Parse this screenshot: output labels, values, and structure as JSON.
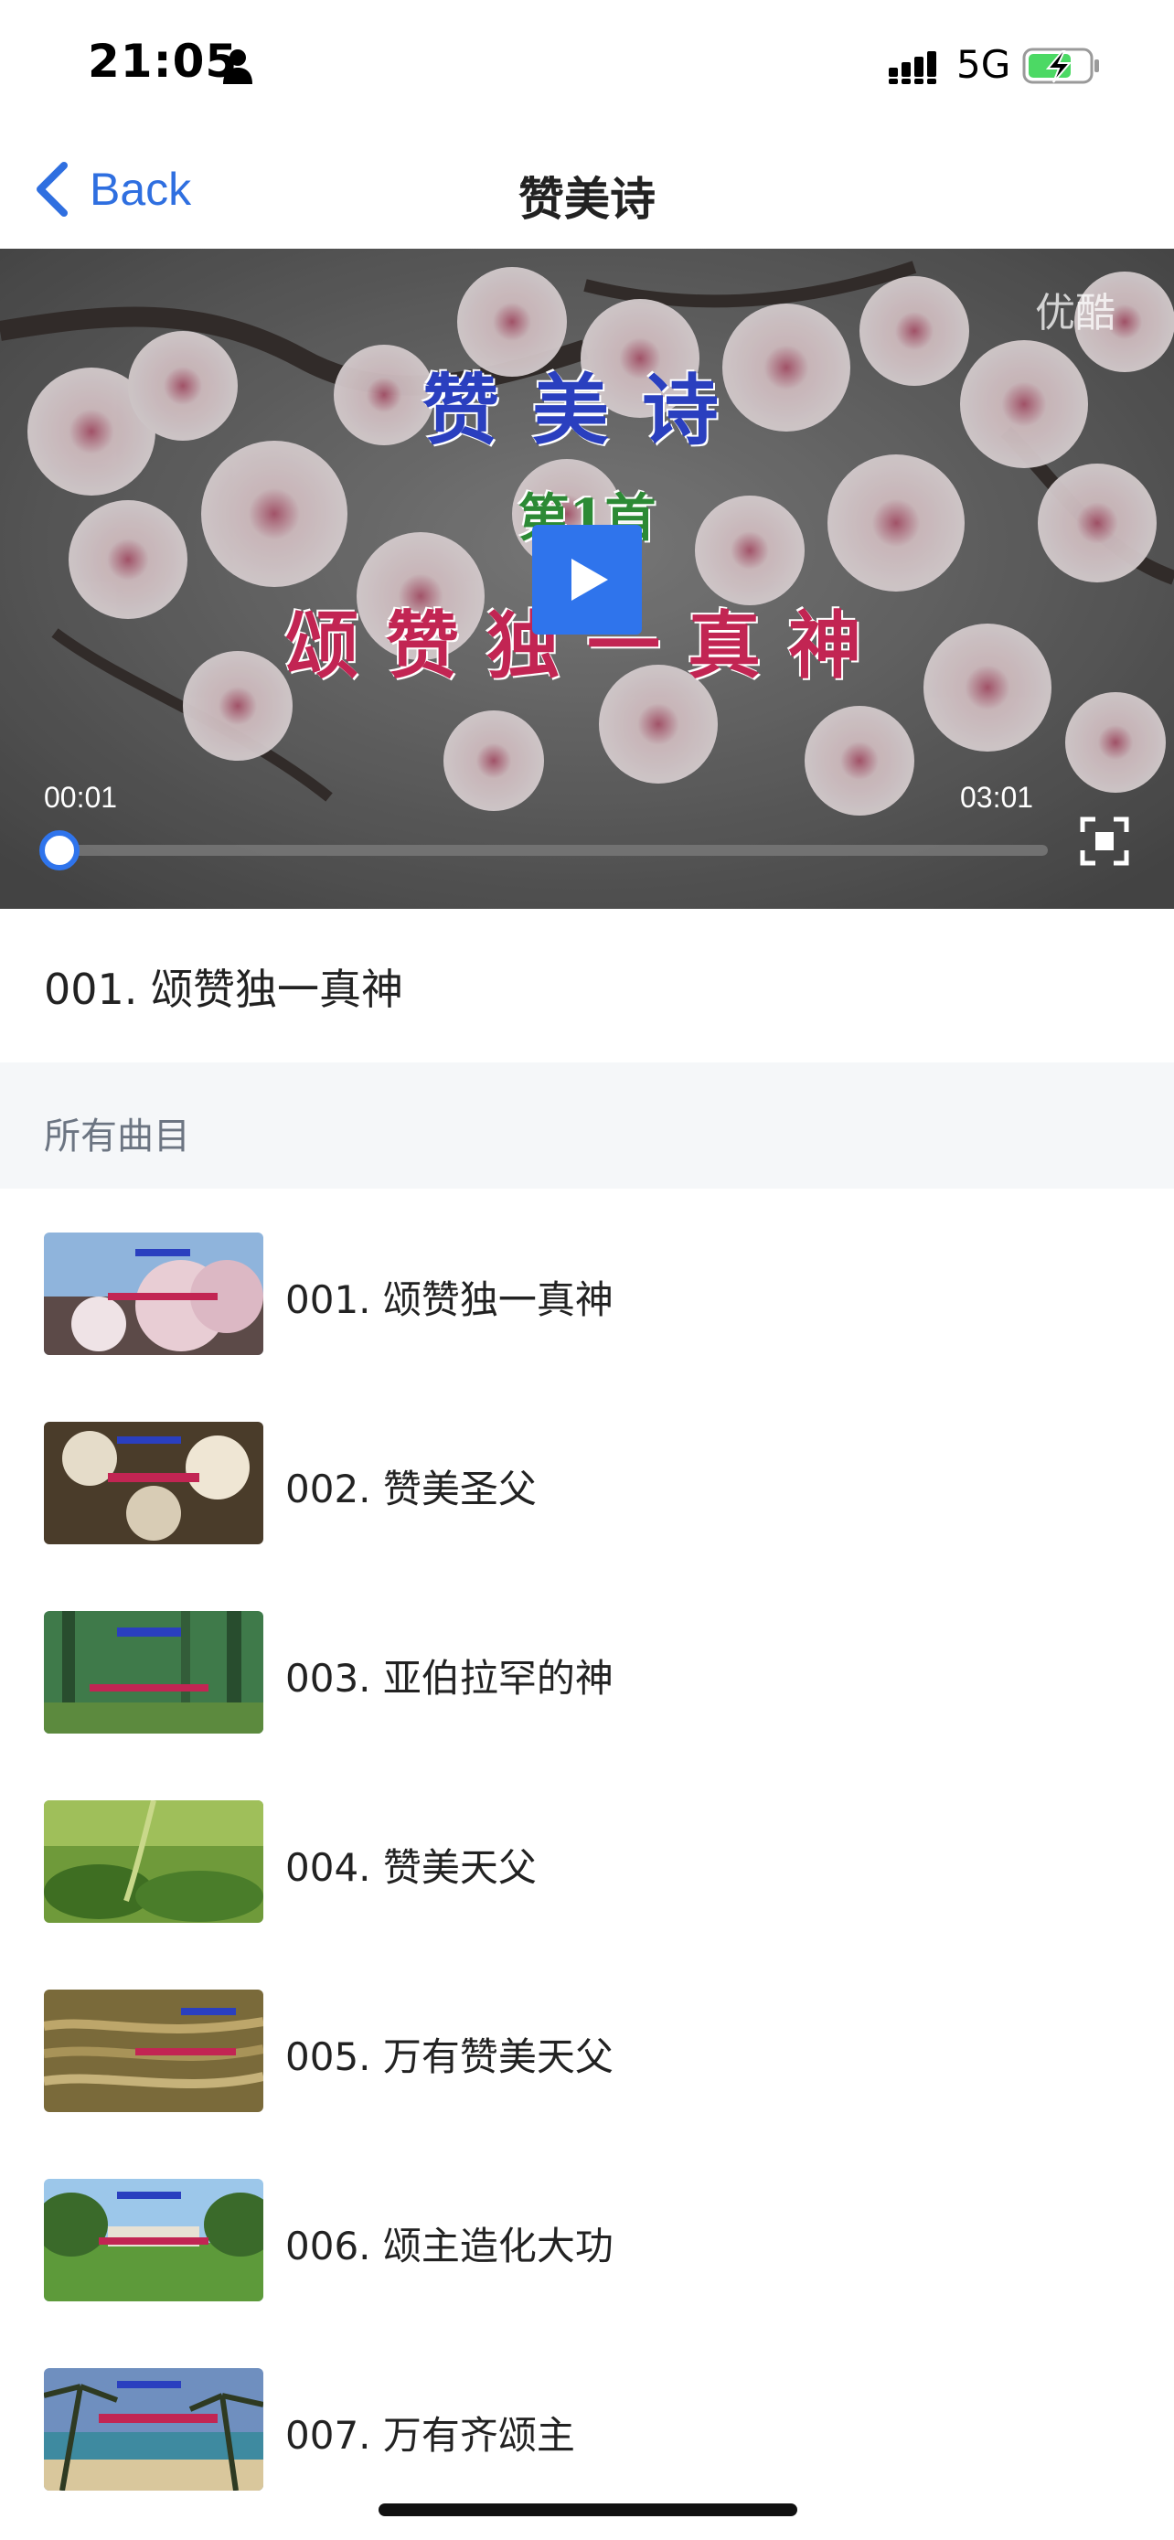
{
  "status_bar": {
    "time": "21:05",
    "network": "5G",
    "icons": [
      "person-icon",
      "signal-icon",
      "battery-charging-icon"
    ],
    "battery_color": "#4cd964"
  },
  "nav": {
    "back_label": "Back",
    "title": "赞美诗",
    "accent_color": "#2f6fe0"
  },
  "player": {
    "overlay_title": "赞美诗",
    "overlay_subtitle": "第1首",
    "overlay_song": "颂赞独一真神",
    "watermark": "优酷",
    "current_time": "00:01",
    "total_time": "03:01",
    "progress": 0.006,
    "play_color": "#2f74ec"
  },
  "now_playing": "001. 颂赞独一真神",
  "section_title": "所有曲目",
  "tracks": [
    {
      "label": "001. 颂赞独一真神"
    },
    {
      "label": "002. 赞美圣父"
    },
    {
      "label": "003. 亚伯拉罕的神"
    },
    {
      "label": "004. 赞美天父"
    },
    {
      "label": "005. 万有赞美天父"
    },
    {
      "label": "006. 颂主造化大功"
    },
    {
      "label": "007. 万有齐颂主"
    }
  ]
}
